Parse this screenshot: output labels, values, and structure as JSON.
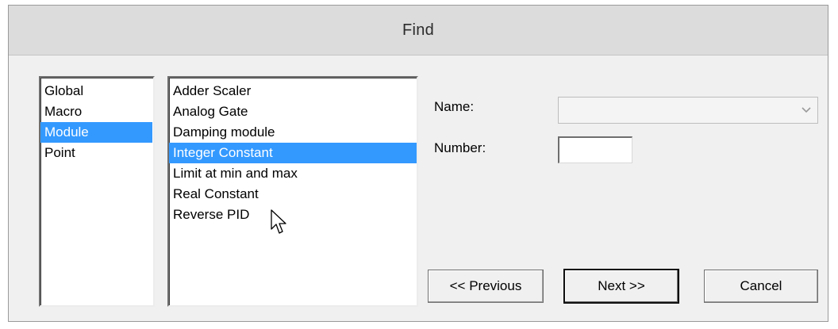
{
  "window": {
    "title": "Find"
  },
  "category_list": {
    "items": [
      "Global",
      "Macro",
      "Module",
      "Point"
    ],
    "selected": "Module"
  },
  "module_list": {
    "items": [
      "Adder Scaler",
      "Analog Gate",
      "Damping module",
      "Integer Constant",
      "Limit at min and max",
      "Real Constant",
      "Reverse PID"
    ],
    "selected": "Integer Constant"
  },
  "form": {
    "name_label": "Name:",
    "name_value": "",
    "number_label": "Number:",
    "number_value": ""
  },
  "buttons": {
    "previous_label": "<< Previous",
    "next_label": "Next >>",
    "cancel_label": "Cancel"
  },
  "icons": {
    "combo_arrow": "chevron-down-icon",
    "cursor": "mouse-pointer-icon"
  },
  "colors": {
    "selection_bg": "#3399ff",
    "selection_fg": "#ffffff",
    "titlebar_bg": "#dcdcdc",
    "dialog_bg": "#f0f0f0"
  }
}
